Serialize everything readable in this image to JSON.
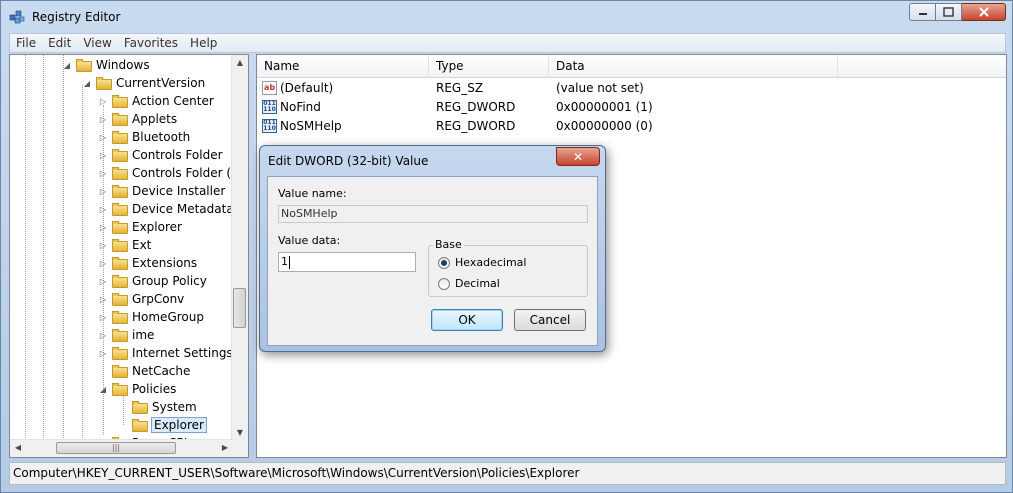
{
  "window": {
    "title": "Registry Editor"
  },
  "menu": [
    "File",
    "Edit",
    "View",
    "Favorites",
    "Help"
  ],
  "tree": {
    "items": [
      {
        "label": "Windows",
        "level": 0,
        "arrow": "expanded"
      },
      {
        "label": "CurrentVersion",
        "level": 1,
        "arrow": "expanded"
      },
      {
        "label": "Action Center",
        "level": 2,
        "arrow": "collapsed"
      },
      {
        "label": "Applets",
        "level": 2,
        "arrow": "collapsed"
      },
      {
        "label": "Bluetooth",
        "level": 2,
        "arrow": "collapsed"
      },
      {
        "label": "Controls Folder",
        "level": 2,
        "arrow": "collapsed"
      },
      {
        "label": "Controls Folder (Wo",
        "level": 2,
        "arrow": "collapsed"
      },
      {
        "label": "Device Installer",
        "level": 2,
        "arrow": "collapsed"
      },
      {
        "label": "Device Metadata",
        "level": 2,
        "arrow": "collapsed"
      },
      {
        "label": "Explorer",
        "level": 2,
        "arrow": "collapsed"
      },
      {
        "label": "Ext",
        "level": 2,
        "arrow": "collapsed"
      },
      {
        "label": "Extensions",
        "level": 2,
        "arrow": "collapsed"
      },
      {
        "label": "Group Policy",
        "level": 2,
        "arrow": "collapsed"
      },
      {
        "label": "GrpConv",
        "level": 2,
        "arrow": "collapsed"
      },
      {
        "label": "HomeGroup",
        "level": 2,
        "arrow": "collapsed"
      },
      {
        "label": "ime",
        "level": 2,
        "arrow": "collapsed"
      },
      {
        "label": "Internet Settings",
        "level": 2,
        "arrow": "collapsed"
      },
      {
        "label": "NetCache",
        "level": 2,
        "arrow": "none"
      },
      {
        "label": "Policies",
        "level": 2,
        "arrow": "expanded"
      },
      {
        "label": "System",
        "level": 3,
        "arrow": "none"
      },
      {
        "label": "Explorer",
        "level": 3,
        "arrow": "none",
        "selected": true
      },
      {
        "label": "PowerCPL",
        "level": 2,
        "arrow": "none"
      }
    ]
  },
  "list": {
    "columns": [
      "Name",
      "Type",
      "Data"
    ],
    "rows": [
      {
        "icon": "string-value-icon",
        "name": "(Default)",
        "type": "REG_SZ",
        "data": "(value not set)"
      },
      {
        "icon": "dword-value-icon",
        "name": "NoFind",
        "type": "REG_DWORD",
        "data": "0x00000001 (1)"
      },
      {
        "icon": "dword-value-icon",
        "name": "NoSMHelp",
        "type": "REG_DWORD",
        "data": "0x00000000 (0)"
      }
    ]
  },
  "status": {
    "path": "Computer\\HKEY_CURRENT_USER\\Software\\Microsoft\\Windows\\CurrentVersion\\Policies\\Explorer"
  },
  "dialog": {
    "title": "Edit DWORD (32-bit) Value",
    "close_glyph": "✕",
    "value_name_label": "Value name:",
    "value_name": "NoSMHelp",
    "value_data_label": "Value data:",
    "value_data": "1",
    "base_label": "Base",
    "hex_label": "Hexadecimal",
    "dec_label": "Decimal",
    "base_selected": "Hexadecimal",
    "ok_label": "OK",
    "cancel_label": "Cancel"
  }
}
